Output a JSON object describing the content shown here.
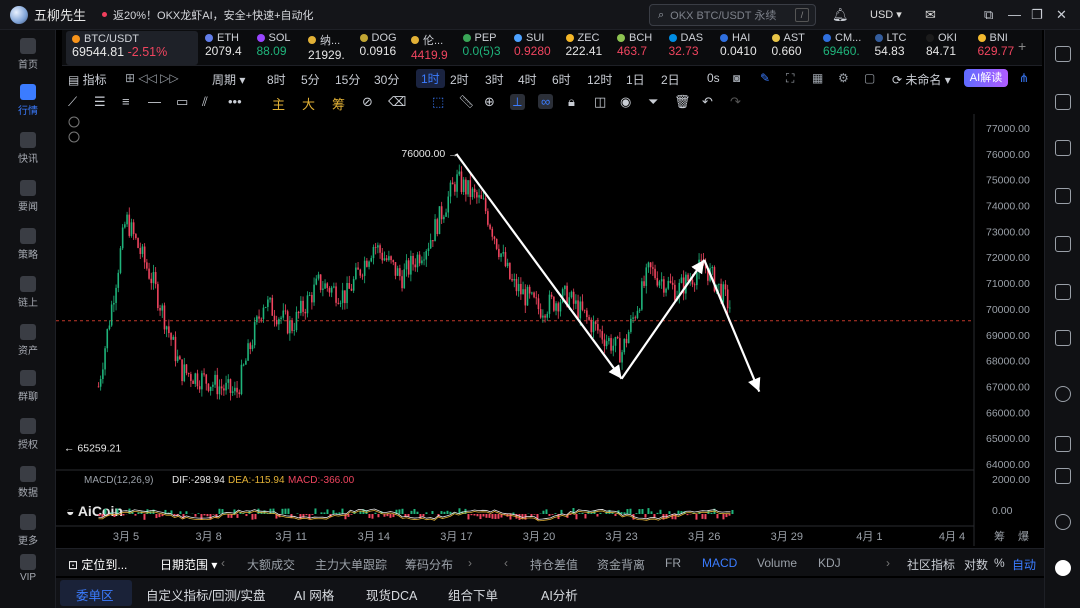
{
  "window": {
    "app_title": "五柳先生",
    "promo_text": "返20%！OKX龙虾AI，安全+快速+自动化",
    "search_placeholder": "OKX BTC/USDT 永续",
    "search_shortcut": "/",
    "currency": "USD"
  },
  "left_nav": [
    {
      "label": "首页",
      "icon": "home-icon"
    },
    {
      "label": "行情",
      "icon": "market-icon",
      "active": true
    },
    {
      "label": "快讯",
      "icon": "flash-news-icon"
    },
    {
      "label": "要闻",
      "icon": "news-icon"
    },
    {
      "label": "策略",
      "icon": "strategy-icon"
    },
    {
      "label": "链上",
      "icon": "onchain-icon"
    },
    {
      "label": "资产",
      "icon": "assets-icon"
    },
    {
      "label": "群聊",
      "icon": "group-chat-icon"
    },
    {
      "label": "授权",
      "icon": "authorize-icon"
    },
    {
      "label": "数据",
      "icon": "data-icon"
    },
    {
      "label": "更多",
      "icon": "more-icon"
    },
    {
      "label": "VIP",
      "icon": "vip-icon"
    }
  ],
  "tickers": {
    "main": {
      "name": "BTC/USDT",
      "price": "69544.81",
      "change": "-2.51%"
    },
    "items": [
      {
        "name": "ETH",
        "price": "2079.4",
        "color": "white",
        "dot": "#627eea"
      },
      {
        "name": "SOL",
        "price": "88.09",
        "color": "green",
        "dot": "#9945ff"
      },
      {
        "name": "纳...",
        "price": "21929.",
        "color": "white",
        "dot": "#e2b136"
      },
      {
        "name": "DOG",
        "price": "0.0916",
        "color": "white",
        "dot": "#c2a633"
      },
      {
        "name": "伦...",
        "price": "4419.9",
        "color": "red",
        "dot": "#e2b136"
      },
      {
        "name": "PEP",
        "price": "0.0(5)3",
        "color": "green",
        "dot": "#3aa657"
      },
      {
        "name": "SUI",
        "price": "0.9280",
        "color": "red",
        "dot": "#4da2ff"
      },
      {
        "name": "ZEC",
        "price": "222.41",
        "color": "white",
        "dot": "#f4b728"
      },
      {
        "name": "BCH",
        "price": "463.7",
        "color": "red",
        "dot": "#8dc351"
      },
      {
        "name": "DAS",
        "price": "32.73",
        "color": "red",
        "dot": "#008de4"
      },
      {
        "name": "HAI",
        "price": "0.0410",
        "color": "white",
        "dot": "#2f6fde"
      },
      {
        "name": "AST",
        "price": "0.660",
        "color": "white",
        "dot": "#e8c547"
      },
      {
        "name": "CM...",
        "price": "69460.",
        "color": "green",
        "dot": "#2f6fde"
      },
      {
        "name": "LTC",
        "price": "54.83",
        "color": "white",
        "dot": "#345d9d"
      },
      {
        "name": "OKI",
        "price": "84.71",
        "color": "white",
        "dot": "#1b1b1b"
      },
      {
        "name": "BNI",
        "price": "629.77",
        "color": "red",
        "dot": "#f3ba2f"
      }
    ]
  },
  "toolbar": {
    "indicators": "指标",
    "period": "周期",
    "timeframes": [
      "8时",
      "5分",
      "15分",
      "30分",
      "1时",
      "2时",
      "3时",
      "4时",
      "6时",
      "12时",
      "1日",
      "2日"
    ],
    "selected_timeframe": "1时",
    "delay": "0s",
    "layout_name": "未命名",
    "ai_button": "AI解读"
  },
  "drawing_tools": {
    "main": "主",
    "big": "大",
    "chips": "筹"
  },
  "chart_data": {
    "type": "candlestick",
    "symbol": "BTC/USDT",
    "y_ticks": [
      "77000.00",
      "76000.00",
      "75000.00",
      "74000.00",
      "73000.00",
      "72000.00",
      "71000.00",
      "70000.00",
      "69000.00",
      "68000.00",
      "67000.00",
      "66000.00",
      "65000.00",
      "64000.00"
    ],
    "x_ticks": [
      "3月 5",
      "3月 8",
      "3月 11",
      "3月 14",
      "3月 17",
      "3月 20",
      "3月 23",
      "3月 26",
      "3月 29",
      "4月 1",
      "4月 4"
    ],
    "ylim": [
      64000,
      77000
    ],
    "current_price": 69544.81,
    "high_label": "76000.00",
    "low_label": "65259.21",
    "high": 76000.0,
    "low": 65259.21,
    "close_path": [
      [
        "3月 4",
        67000
      ],
      [
        "3月 5",
        73500
      ],
      [
        "3月 6",
        71000
      ],
      [
        "3月 7",
        67600
      ],
      [
        "3月 8",
        67200
      ],
      [
        "3月 9",
        66700
      ],
      [
        "3月 10",
        70300
      ],
      [
        "3月 11",
        69300
      ],
      [
        "3月 12",
        71000
      ],
      [
        "3月 13",
        70500
      ],
      [
        "3月 14",
        72500
      ],
      [
        "3月 15",
        71200
      ],
      [
        "3月 16",
        72600
      ],
      [
        "3月 17",
        75000
      ],
      [
        "3月 18",
        74000
      ],
      [
        "3月 19",
        71000
      ],
      [
        "3月 20",
        70000
      ],
      [
        "3月 21",
        70500
      ],
      [
        "3月 22",
        69300
      ],
      [
        "3月 23",
        68300
      ],
      [
        "3月 24",
        71500
      ],
      [
        "3月 25",
        70700
      ],
      [
        "3月 26",
        71700
      ],
      [
        "3月 27",
        70000
      ]
    ],
    "annotation_arrows": [
      {
        "from": [
          "3月 17",
          76000
        ],
        "to": [
          "3月 23",
          67300
        ]
      },
      {
        "from": [
          "3月 23",
          67300
        ],
        "to": [
          "3月 26",
          71900
        ]
      },
      {
        "from": [
          "3月 26",
          71900
        ],
        "to": [
          "3月 28",
          66800
        ]
      }
    ]
  },
  "macd": {
    "label": "MACD(12,26,9)",
    "dif": "DIF:-298.94",
    "dea": "DEA:-115.94",
    "macd": "MACD:-366.00",
    "y_ticks": [
      "2000.00",
      "0.00"
    ],
    "watermark": "AiCoin"
  },
  "corner_labels": {
    "a": "筹",
    "b": "爆"
  },
  "bottom_bar": {
    "locate": "定位到...",
    "date_range": "日期范围",
    "tabs": [
      "大额成交",
      "主力大单跟踪",
      "筹码分布",
      "持仓差值",
      "资金背离",
      "FR",
      "MACD",
      "Volume",
      "KDJ"
    ],
    "active_tab": "MACD",
    "community": "社区指标",
    "log": "对数",
    "percent": "%",
    "auto": "自动"
  },
  "bottom_tabs": {
    "items": [
      "委单区",
      "自定义指标/回测/实盘",
      "AI 网格",
      "现货DCA",
      "组合下单",
      "AI分析"
    ],
    "active": "委单区"
  }
}
